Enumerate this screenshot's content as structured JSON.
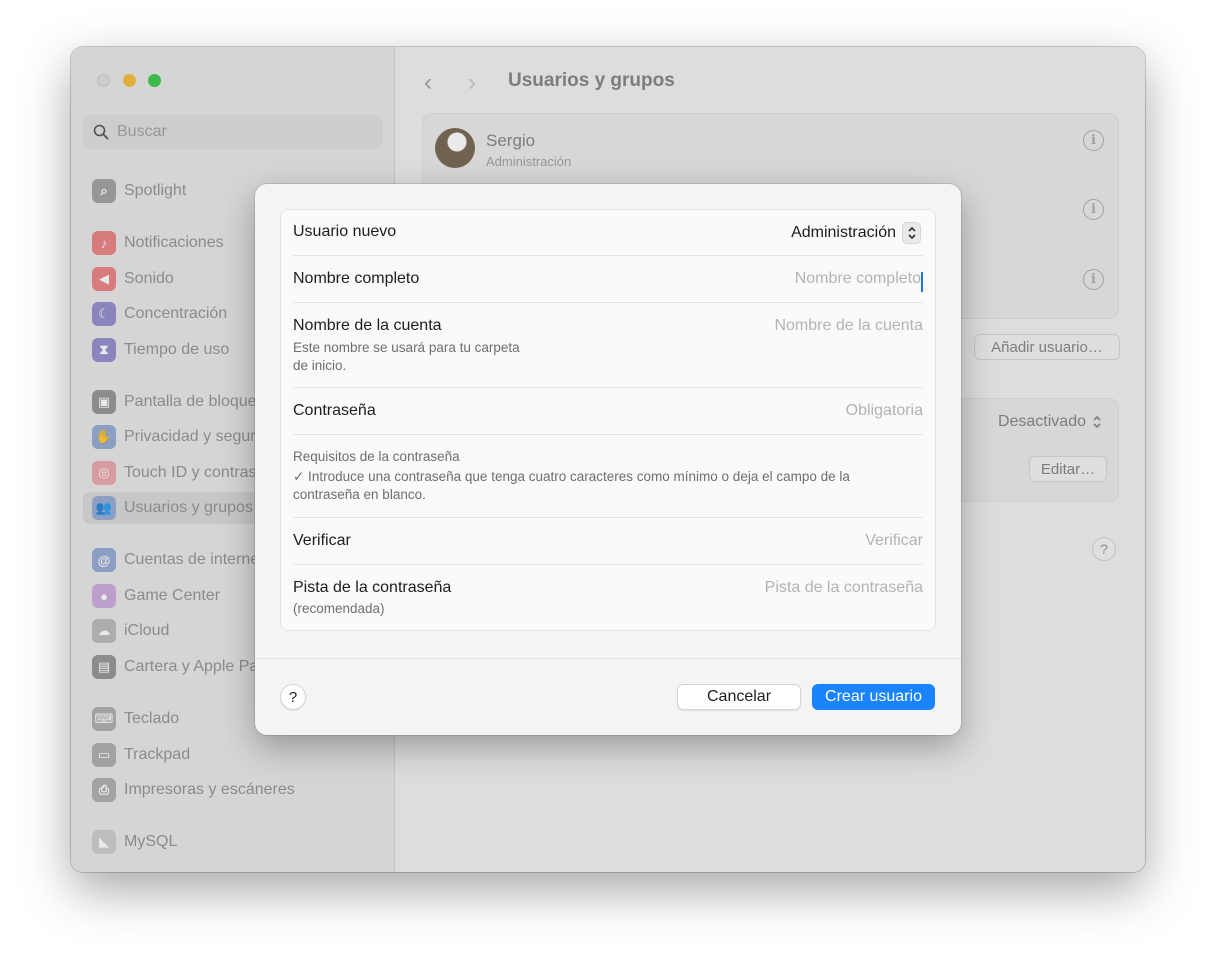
{
  "sidebar": {
    "search_placeholder": "Buscar",
    "items": [
      {
        "label": "Spotlight",
        "icon": "spotlight-icon",
        "color": "#9a9a9a"
      },
      {
        "label": "Notificaciones",
        "icon": "bell-icon",
        "color": "#e8787a"
      },
      {
        "label": "Sonido",
        "icon": "speaker-icon",
        "color": "#e8787a"
      },
      {
        "label": "Concentración",
        "icon": "moon-icon",
        "color": "#8a85c8"
      },
      {
        "label": "Tiempo de uso",
        "icon": "hourglass-icon",
        "color": "#8a85c8"
      },
      {
        "label": "Pantalla de bloqueo",
        "icon": "lock-icon",
        "color": "#8d8d8d"
      },
      {
        "label": "Privacidad y seguridad",
        "icon": "hand-icon",
        "color": "#8ba4cf"
      },
      {
        "label": "Touch ID y contraseña",
        "icon": "fingerprint-icon",
        "color": "#e8a0a8"
      },
      {
        "label": "Usuarios y grupos",
        "icon": "users-icon",
        "color": "#8ba4cf",
        "selected": true
      },
      {
        "label": "Cuentas de internet",
        "icon": "at-icon",
        "color": "#8ba4cf"
      },
      {
        "label": "Game Center",
        "icon": "game-center-icon",
        "color": "#c9a3d8"
      },
      {
        "label": "iCloud",
        "icon": "cloud-icon",
        "color": "#b5b5b5"
      },
      {
        "label": "Cartera y Apple Pay",
        "icon": "wallet-icon",
        "color": "#8d8d8d"
      },
      {
        "label": "Teclado",
        "icon": "keyboard-icon",
        "color": "#a8a8a8"
      },
      {
        "label": "Trackpad",
        "icon": "trackpad-icon",
        "color": "#a8a8a8"
      },
      {
        "label": "Impresoras y escáneres",
        "icon": "printer-icon",
        "color": "#a8a8a8"
      },
      {
        "label": "MySQL",
        "icon": "mysql-icon",
        "color": "#c8c8c8"
      }
    ]
  },
  "main": {
    "title": "Usuarios y grupos",
    "user_name": "Sergio",
    "user_role": "Administración",
    "add_user_label": "Añadir usuario…",
    "auto_login_value": "Desactivado",
    "edit_label": "Editar…",
    "help_label": "?"
  },
  "sheet": {
    "new_user_label": "Usuario nuevo",
    "new_user_type": "Administración",
    "full_name_label": "Nombre completo",
    "full_name_placeholder": "Nombre completo",
    "account_name_label": "Nombre de la cuenta",
    "account_name_sub1": "Este nombre se usará para tu carpeta",
    "account_name_sub2": "de inicio.",
    "account_name_placeholder": "Nombre de la cuenta",
    "password_label": "Contraseña",
    "password_placeholder": "Obligatoria",
    "requirements_title": "Requisitos de la contraseña",
    "requirements_line1": "✓ Introduce una contraseña que tenga cuatro caracteres como mínimo o deja el campo de la",
    "requirements_line2": "contraseña en blanco.",
    "verify_label": "Verificar",
    "verify_placeholder": "Verificar",
    "hint_label": "Pista de la contraseña",
    "hint_sub": "(recomendada)",
    "hint_placeholder": "Pista de la contraseña",
    "help_label": "?",
    "cancel_label": "Cancelar",
    "create_label": "Crear usuario"
  }
}
